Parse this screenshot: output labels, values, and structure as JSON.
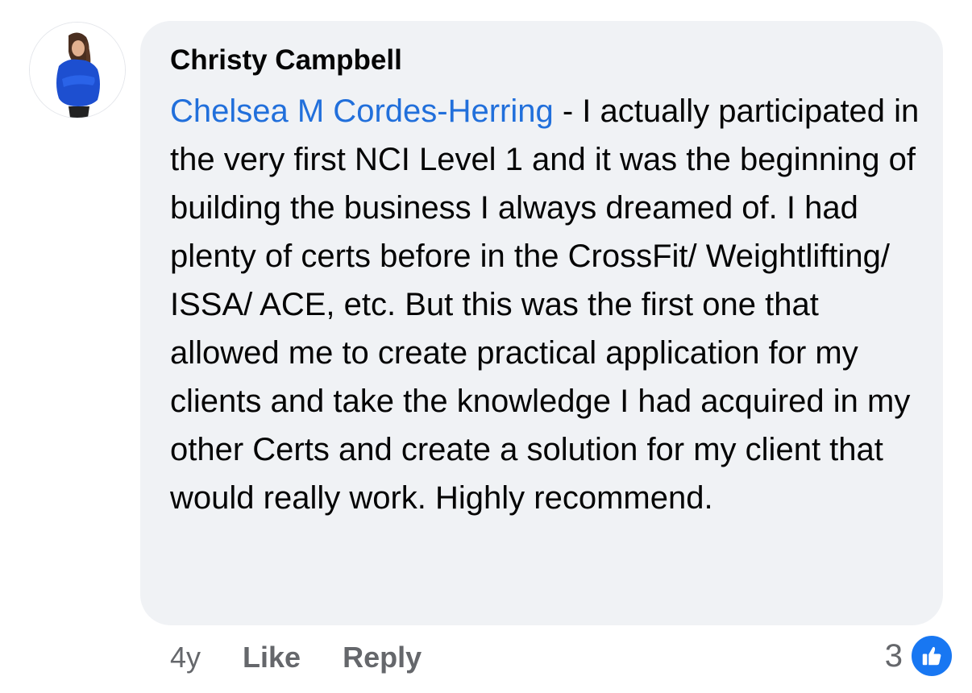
{
  "comment": {
    "author": "Christy Campbell",
    "mention": "Chelsea M Cordes-Herring",
    "body": " - I actually participated in the very first NCI Level 1 and it was the beginning of building the business I always dreamed of.  I had plenty of certs before in the CrossFit/ Weightlifting/ ISSA/ ACE, etc.  But this was the first one that allowed me to create practical application for my clients and take the knowledge I had acquired in my other Certs and create a solution for my client that would really work. Highly recommend."
  },
  "actions": {
    "time": "4y",
    "like_label": "Like",
    "reply_label": "Reply"
  },
  "reactions": {
    "count": "3",
    "icon": "thumbs-up-icon"
  },
  "colors": {
    "mention": "#216fdb",
    "bubble": "#f0f2f5",
    "secondary_text": "#65676b",
    "like_badge": "#1877f2"
  }
}
